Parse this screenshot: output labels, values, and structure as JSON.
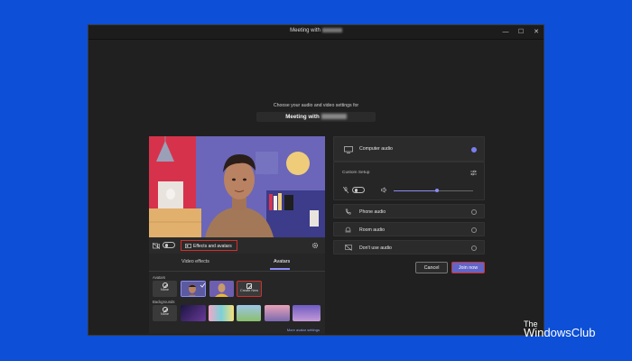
{
  "window": {
    "title_prefix": "Meeting with",
    "controls": {
      "minimize": "—",
      "maximize": "☐",
      "close": "✕"
    }
  },
  "prompt": "Choose your audio and video settings for",
  "meeting_name_prefix": "Meeting with",
  "video_controls": {
    "effects_label": "Effects and avatars"
  },
  "effects_panel": {
    "tabs": [
      {
        "label": "Video effects"
      },
      {
        "label": "Avatars",
        "active": true
      }
    ],
    "avatars_section": "Avatars",
    "backgrounds_section": "Backgrounds",
    "none_label": "None",
    "create_new_label": "Create New",
    "more_settings_label": "More avatar settings"
  },
  "audio_options": {
    "computer_audio": "Computer audio",
    "custom_setup": "Custom Setup",
    "phone_audio": "Phone audio",
    "room_audio": "Room audio",
    "dont_use_audio": "Don't use audio"
  },
  "volume_level": 0.55,
  "buttons": {
    "cancel": "Cancel",
    "join_now": "Join now"
  },
  "watermark": {
    "prefix": "The",
    "name": "WindowsClub"
  },
  "colors": {
    "accent": "#7b7ef0",
    "highlight_border": "#d0312d",
    "background": "#0d4fd6"
  }
}
